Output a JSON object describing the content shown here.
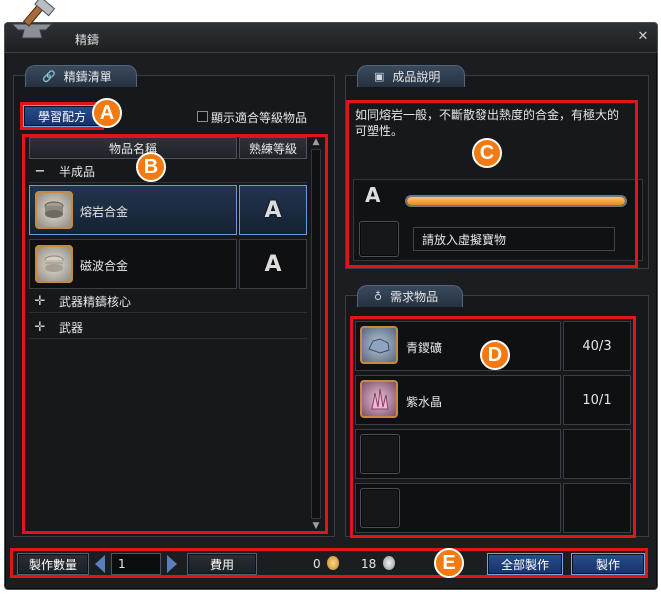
{
  "window": {
    "title": "精鑄"
  },
  "left_panel": {
    "tab_title": "精鑄清單",
    "learn_button": "學習配方",
    "filter_checkbox_label": "顯示適合等級物品",
    "filter_checked": false,
    "columns": [
      "物品名稱",
      "熟練等級"
    ],
    "categories": [
      {
        "sign": "−",
        "label": "半成品",
        "expanded": true
      },
      {
        "sign": "✛",
        "label": "武器精鑄核心",
        "expanded": false
      },
      {
        "sign": "✛",
        "label": "武器",
        "expanded": false
      }
    ],
    "items": [
      {
        "name": "熔岩合金",
        "grade": "A",
        "selected": true
      },
      {
        "name": "磁波合金",
        "grade": "A",
        "selected": false
      }
    ]
  },
  "product_panel": {
    "tab_title": "成品說明",
    "description_line1": "如同熔岩一般，不斷散發出熱度的合金，有極大的",
    "description_line2": "可塑性。",
    "grade": "A",
    "progress": 1.0,
    "slot_placeholder": "請放入虛擬寶物"
  },
  "materials_panel": {
    "tab_title": "需求物品",
    "materials": [
      {
        "name": "青鑁礦",
        "count": "40/3"
      },
      {
        "name": "紫水晶",
        "count": "10/1"
      },
      {
        "name": "",
        "count": ""
      },
      {
        "name": "",
        "count": ""
      }
    ]
  },
  "bottom_bar": {
    "qty_label": "製作數量",
    "qty_value": "1",
    "fee_button": "費用",
    "gold_amount": "0",
    "silver_amount": "18",
    "make_all_button": "全部製作",
    "make_button": "製作"
  },
  "annotations": {
    "a": "A",
    "b": "B",
    "c": "C",
    "d": "D",
    "e": "E"
  },
  "colors": {
    "accent_red": "#e01419",
    "marker_orange": "#f27a10",
    "progress_orange": "#f29a2e",
    "selected_blue": "#6f9bd2"
  }
}
